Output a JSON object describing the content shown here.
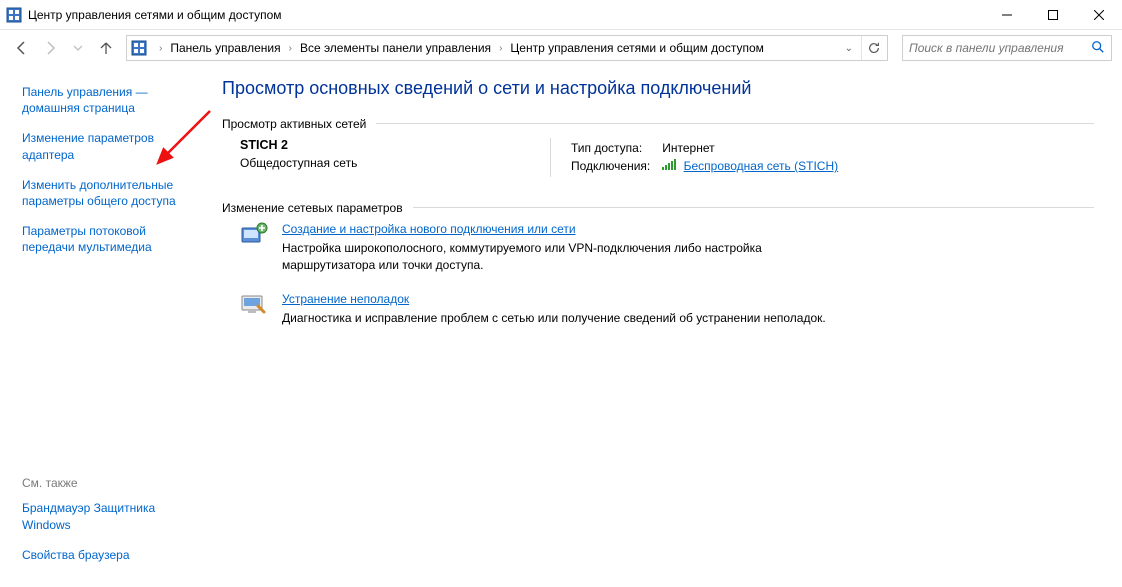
{
  "window": {
    "title": "Центр управления сетями и общим доступом"
  },
  "breadcrumb": {
    "items": [
      "Панель управления",
      "Все элементы панели управления",
      "Центр управления сетями и общим доступом"
    ]
  },
  "search": {
    "placeholder": "Поиск в панели управления"
  },
  "sidebar": {
    "links": [
      "Панель управления — домашняя страница",
      "Изменение параметров адаптера",
      "Изменить дополнительные параметры общего доступа",
      "Параметры потоковой передачи мультимедиа"
    ],
    "see_also_label": "См. также",
    "bottom_links": [
      "Брандмауэр Защитника Windows",
      "Свойства браузера"
    ]
  },
  "content": {
    "page_title": "Просмотр основных сведений о сети и настройка подключений",
    "active_networks_label": "Просмотр активных сетей",
    "network": {
      "name": "STICH 2",
      "type": "Общедоступная сеть",
      "access_label": "Тип доступа:",
      "access_value": "Интернет",
      "connections_label": "Подключения:",
      "connection_link": "Беспроводная сеть (STICH)"
    },
    "change_settings_label": "Изменение сетевых параметров",
    "items": [
      {
        "title": "Создание и настройка нового подключения или сети",
        "desc": "Настройка широкополосного, коммутируемого или VPN-подключения либо настройка маршрутизатора или точки доступа."
      },
      {
        "title": "Устранение неполадок",
        "desc": "Диагностика и исправление проблем с сетью или получение сведений об устранении неполадок."
      }
    ]
  }
}
